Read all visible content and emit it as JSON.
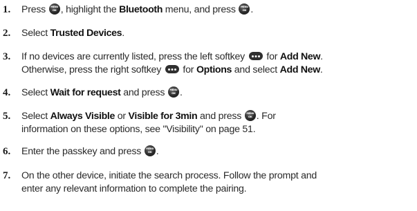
{
  "steps": [
    {
      "number": "1.",
      "lines": [
        [
          "Press ",
          {
            "icon": "menu-ok-key"
          },
          ", highlight the ",
          {
            "bold": "Bluetooth"
          },
          " menu, and press ",
          {
            "icon": "menu-ok-key"
          },
          "."
        ]
      ]
    },
    {
      "number": "2.",
      "lines": [
        [
          "Select ",
          {
            "bold": "Trusted Devices"
          },
          "."
        ]
      ]
    },
    {
      "number": "3.",
      "lines": [
        [
          "If no devices are currently listed, press the left softkey ",
          {
            "icon": "softkey"
          },
          " for ",
          {
            "bold": "Add New"
          },
          "."
        ],
        [
          "Otherwise, press the right softkey ",
          {
            "icon": "softkey"
          },
          " for ",
          {
            "bold": "Options"
          },
          " and select ",
          {
            "bold": "Add New"
          },
          "."
        ]
      ]
    },
    {
      "number": "4.",
      "lines": [
        [
          "Select ",
          {
            "bold": "Wait for request"
          },
          " and press ",
          {
            "icon": "menu-ok-key"
          },
          "."
        ]
      ]
    },
    {
      "number": "5.",
      "lines": [
        [
          "Select ",
          {
            "bold": "Always Visible"
          },
          " or ",
          {
            "bold": "Visible for 3min"
          },
          " and press ",
          {
            "icon": "menu-ok-key"
          },
          ". For"
        ],
        [
          "information on these options, see \"Visibility\" on page 51."
        ]
      ]
    },
    {
      "number": "6.",
      "lines": [
        [
          "Enter the passkey and press ",
          {
            "icon": "menu-ok-key"
          },
          "."
        ]
      ]
    },
    {
      "number": "7.",
      "lines": [
        [
          "On the other device, initiate the search process. Follow the prompt and"
        ],
        [
          "enter any relevant information to complete the pairing."
        ]
      ]
    }
  ]
}
